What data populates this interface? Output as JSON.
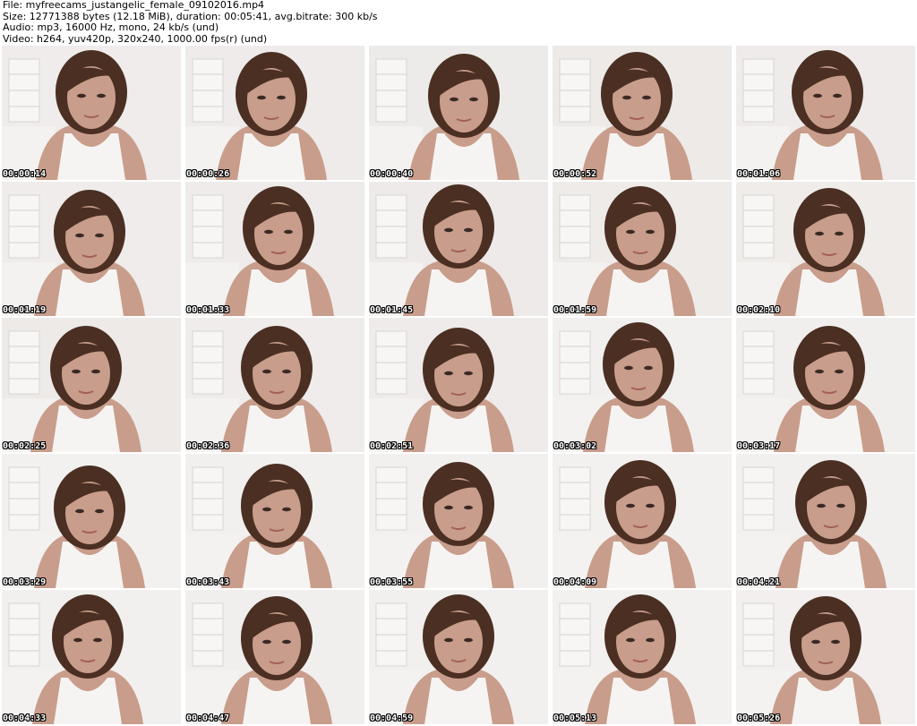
{
  "header": {
    "file_line": "File: myfreecams_justangelic_female_09102016.mp4",
    "size_line": "Size: 12771388 bytes (12.18 MiB), duration: 00:05:41, avg.bitrate: 300 kb/s",
    "audio_line": "Audio: mp3, 16000 Hz, mono, 24 kb/s (und)",
    "video_line": "Video: h264, yuv420p, 320x240, 1000.00 fps(r) (und)"
  },
  "colors": {
    "background": "#ffffff",
    "text": "#000000",
    "timestamp_fill": "#ffffff",
    "timestamp_outline": "#000000",
    "wall": "#efeceb",
    "hair": "#4a2f22",
    "skin": "#c99d8b",
    "shirt": "#f6f4f3"
  },
  "thumbnails": [
    {
      "timestamp": "00:00:14"
    },
    {
      "timestamp": "00:00:26"
    },
    {
      "timestamp": "00:00:40"
    },
    {
      "timestamp": "00:00:52"
    },
    {
      "timestamp": "00:01:06"
    },
    {
      "timestamp": "00:01:19"
    },
    {
      "timestamp": "00:01:33"
    },
    {
      "timestamp": "00:01:45"
    },
    {
      "timestamp": "00:01:59"
    },
    {
      "timestamp": "00:02:10"
    },
    {
      "timestamp": "00:02:25"
    },
    {
      "timestamp": "00:02:36"
    },
    {
      "timestamp": "00:02:51"
    },
    {
      "timestamp": "00:03:02"
    },
    {
      "timestamp": "00:03:17"
    },
    {
      "timestamp": "00:03:29"
    },
    {
      "timestamp": "00:03:43"
    },
    {
      "timestamp": "00:03:55"
    },
    {
      "timestamp": "00:04:09"
    },
    {
      "timestamp": "00:04:21"
    },
    {
      "timestamp": "00:04:33"
    },
    {
      "timestamp": "00:04:47"
    },
    {
      "timestamp": "00:04:59"
    },
    {
      "timestamp": "00:05:13"
    },
    {
      "timestamp": "00:05:26"
    }
  ]
}
